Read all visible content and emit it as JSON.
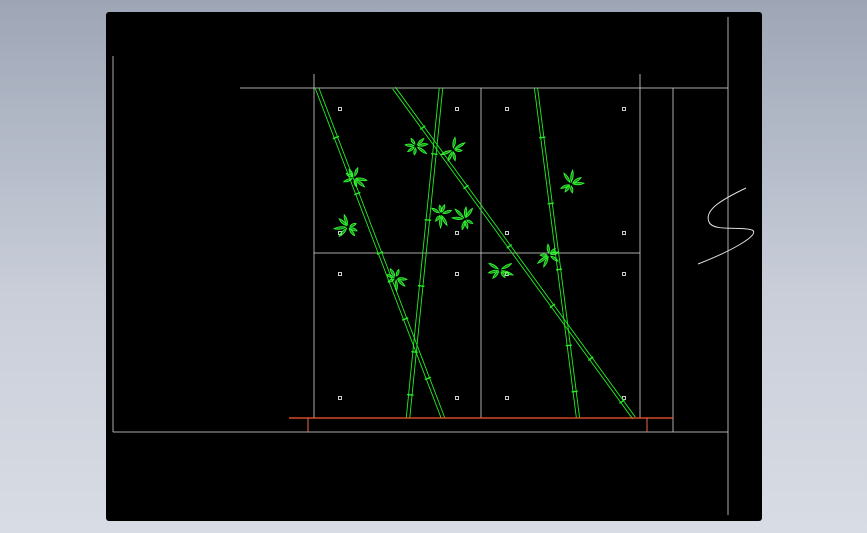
{
  "viewport": {
    "background": "#000000",
    "surround_background": "#b4bac7"
  },
  "drawing": {
    "type": "cad-elevation",
    "subject": "bamboo-wall-elevation",
    "colors": {
      "frame_line": "#c8c8c8",
      "bamboo": "#22ee22",
      "leaf": "#33ff33",
      "base_line": "#ff5533",
      "anchor_dot": "#ffffff",
      "break_mark": "#dddddd"
    },
    "grid": {
      "columns": 2,
      "rows": 2
    },
    "bamboo_stalk_count": 4,
    "leaf_cluster_count": 10,
    "anchor_dot_count": 16,
    "has_break_mark": true,
    "has_base_line": true
  }
}
